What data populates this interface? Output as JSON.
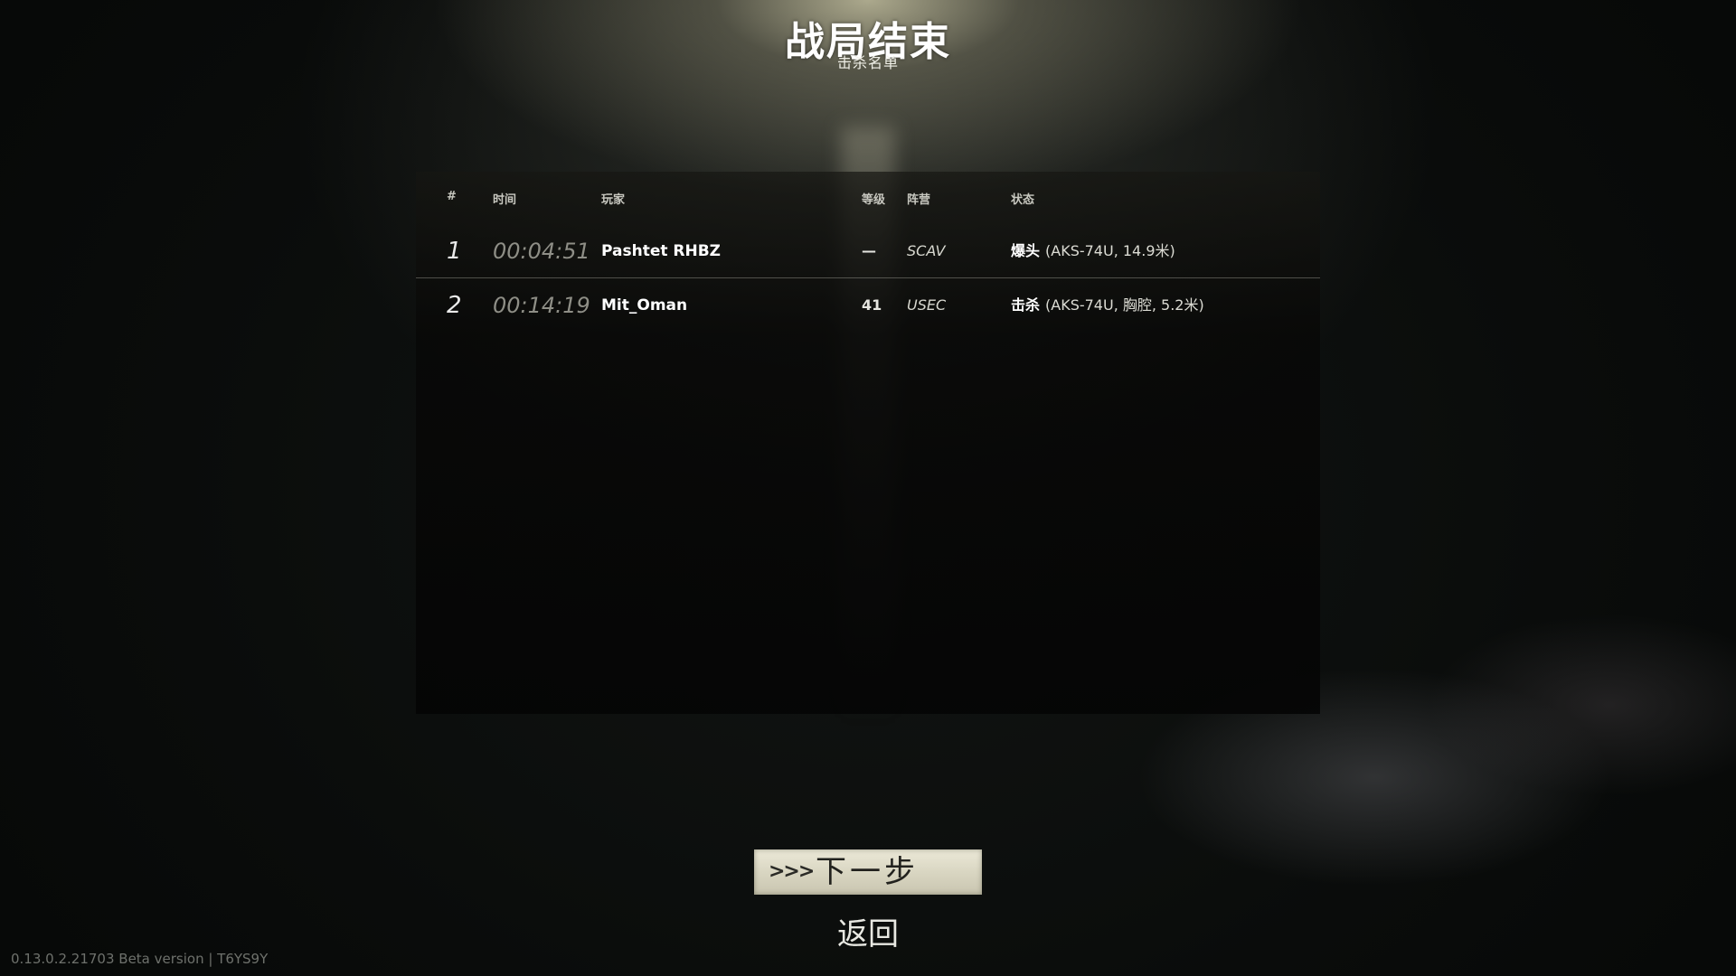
{
  "header": {
    "title": "战局结束",
    "subtitle": "击杀名单"
  },
  "table": {
    "columns": {
      "index": "#",
      "time": "时间",
      "player": "玩家",
      "level": "等级",
      "faction": "阵营",
      "status": "状态"
    },
    "rows": [
      {
        "index": "1",
        "time": "00:04:51",
        "player": "Pashtet RHBZ",
        "level": "—",
        "faction": "SCAV",
        "status_type": "爆头",
        "status_detail": "(AKS-74U, 14.9米)"
      },
      {
        "index": "2",
        "time": "00:14:19",
        "player": "Mit_Oman",
        "level": "41",
        "faction": "USEC",
        "status_type": "击杀",
        "status_detail": "(AKS-74U, 胸腔, 5.2米)"
      }
    ]
  },
  "actions": {
    "next_arrows": ">>>",
    "next_label": "下一步",
    "back_label": "返回"
  },
  "footer": {
    "version": "0.13.0.2.21703 Beta version | T6YS9Y"
  }
}
